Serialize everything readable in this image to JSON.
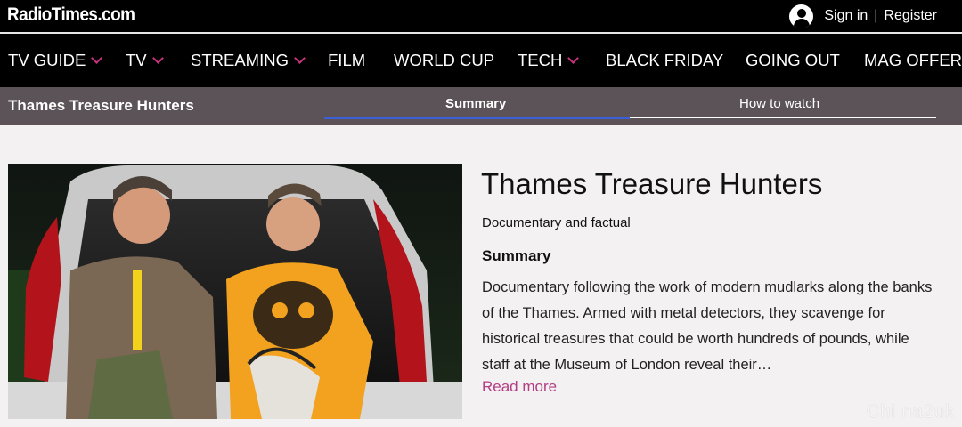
{
  "header": {
    "logo": "RadioTimes.com",
    "sign_in": "Sign in",
    "separator": "|",
    "register": "Register"
  },
  "nav": {
    "items": [
      {
        "label": "TV GUIDE",
        "has_dropdown": true
      },
      {
        "label": "TV",
        "has_dropdown": true
      },
      {
        "label": "STREAMING",
        "has_dropdown": true
      },
      {
        "label": "FILM",
        "has_dropdown": false
      },
      {
        "label": "WORLD CUP",
        "has_dropdown": false
      },
      {
        "label": "TECH",
        "has_dropdown": true
      },
      {
        "label": "BLACK FRIDAY",
        "has_dropdown": false
      },
      {
        "label": "GOING OUT",
        "has_dropdown": false
      },
      {
        "label": "MAG OFFER",
        "has_dropdown": false
      }
    ]
  },
  "subbar": {
    "show_title": "Thames Treasure Hunters",
    "tabs": [
      {
        "label": "Summary",
        "active": true
      },
      {
        "label": "How to watch",
        "active": false
      }
    ]
  },
  "content": {
    "title": "Thames Treasure Hunters",
    "genre": "Documentary and factual",
    "summary_heading": "Summary",
    "summary_text": "Documentary following the work of modern mudlarks along the banks of the Thames. Armed with metal detectors, they scavenge for historical treasures that could be worth hundreds of pounds, while staff at the Museum of London reveal their…",
    "read_more": "Read more",
    "hero_alt": "Two men sitting in the open boot of a car"
  },
  "watermark": "Chi na2uk",
  "colors": {
    "nav_bg": "#000000",
    "subbar_bg": "#5b5357",
    "accent_pink": "#c8327e",
    "link_pink": "#b23d82",
    "active_tab_blue": "#3a5fd8",
    "page_bg": "#f4f1f3"
  }
}
